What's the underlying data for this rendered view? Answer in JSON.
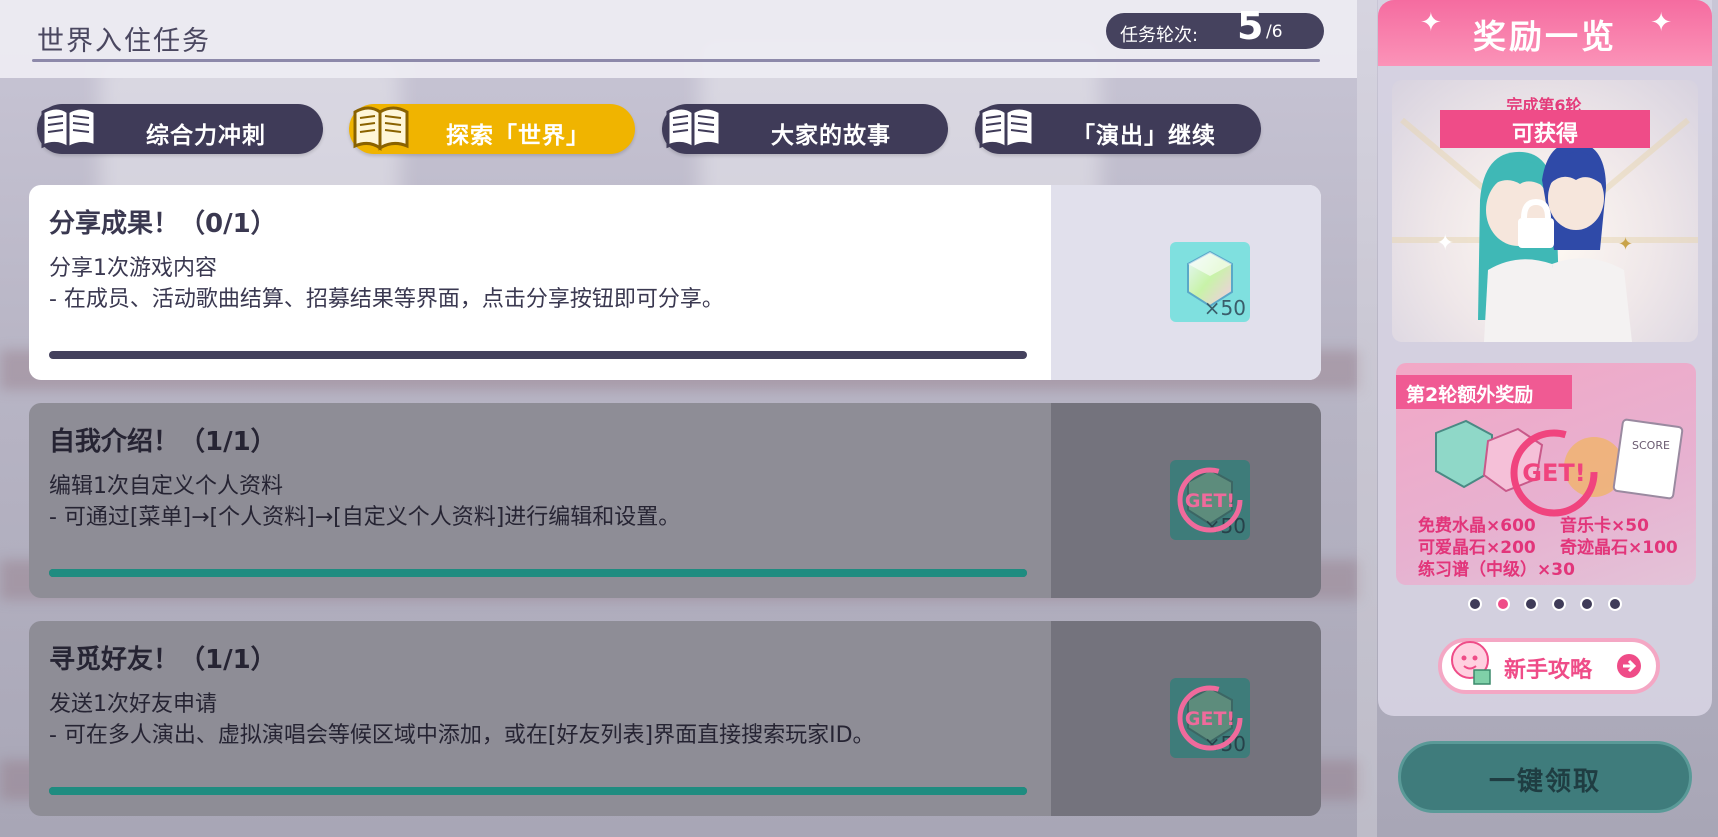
{
  "header": {
    "title": "世界入住任务",
    "round_label": "任务轮次:",
    "round_current": "5",
    "round_total": "/6"
  },
  "tabs": [
    {
      "label": "综合力冲刺",
      "active": false
    },
    {
      "label": "探索「世界」",
      "active": true
    },
    {
      "label": "大家的故事",
      "active": false
    },
    {
      "label": "「演出」继续",
      "active": false
    }
  ],
  "missions": [
    {
      "title": "分享成果！（0/1）",
      "desc": "分享1次游戏内容",
      "detail": "- 在成员、活动歌曲结算、招募结果等界面，点击分享按钮即可分享。",
      "reward_qty": "×50",
      "progress": 0,
      "done": false
    },
    {
      "title": "自我介绍！（1/1）",
      "desc": "编辑1次自定义个人资料",
      "detail": "- 可通过[菜单]→[个人资料]→[自定义个人资料]进行编辑和设置。",
      "reward_qty": "×50",
      "stamp": "GET!",
      "progress": 1,
      "done": true
    },
    {
      "title": "寻觅好友！（1/1）",
      "desc": "发送1次好友申请",
      "detail": "- 可在多人演出、虚拟演唱会等候区域中添加，或在[好友列表]界面直接搜索玩家ID。",
      "reward_qty": "×50",
      "stamp": "GET!",
      "progress": 1,
      "done": true
    }
  ],
  "rewards_panel": {
    "title": "奖励一览",
    "complete_caption": "完成第6轮",
    "obtainable": "可获得",
    "bonus_tag": "第2轮额外奖励",
    "bonus_stamp": "GET!",
    "bonus_score_label": "SCORE",
    "bonus_items": [
      "免费水晶×600",
      "音乐卡×50",
      "可爱晶石×200",
      "奇迹晶石×100",
      "练习谱（中级）×30"
    ],
    "carousel_index": 2,
    "carousel_count": 6,
    "guide_button": "新手攻略"
  },
  "claim_all_button": "一键领取",
  "colors": {
    "accent_yellow": "#f0b400",
    "navy": "#3f3b58",
    "pink": "#ef4c88",
    "teal": "#3f7c7c"
  }
}
